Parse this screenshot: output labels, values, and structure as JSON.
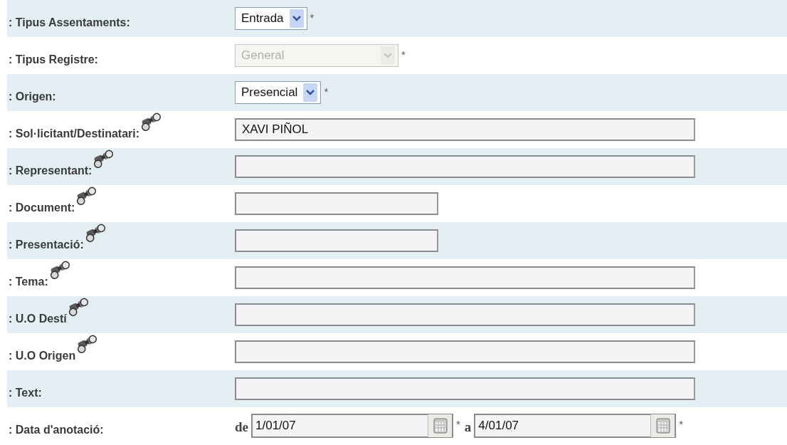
{
  "rows": [
    {
      "kind": "select",
      "label": ": Tipus Assentaments:",
      "search_icon": false,
      "value": "Entrada",
      "disabled": false,
      "required": true
    },
    {
      "kind": "select",
      "label": ": Tipus Registre:",
      "search_icon": false,
      "value": "General",
      "disabled": true,
      "required": true
    },
    {
      "kind": "select",
      "label": ": Origen:",
      "search_icon": false,
      "value": "Presencial",
      "disabled": false,
      "required": true
    },
    {
      "kind": "wide_text",
      "label": ": Sol·licitant/Destinatari:",
      "search_icon": true,
      "value": "XAVI PIÑOL"
    },
    {
      "kind": "wide_text",
      "label": ": Representant:",
      "search_icon": true
    },
    {
      "kind": "short_text",
      "label": ": Document:",
      "search_icon": true
    },
    {
      "kind": "short_text",
      "label": ": Presentació:",
      "search_icon": true
    },
    {
      "kind": "wide_text",
      "label": ": Tema:",
      "search_icon": true
    },
    {
      "kind": "wide_text",
      "label": ": U.O Destí",
      "search_icon": true
    },
    {
      "kind": "wide_text",
      "label": ": U.O Origen",
      "search_icon": true
    },
    {
      "kind": "wide_text",
      "label": ": Text:",
      "search_icon": false
    },
    {
      "kind": "date_range",
      "label": ": Data d'anotació:",
      "search_icon": false,
      "from_label": "de",
      "from": "1/01/07",
      "to_label": "a",
      "to": "4/01/07",
      "required": true
    }
  ],
  "required_mark": "*"
}
